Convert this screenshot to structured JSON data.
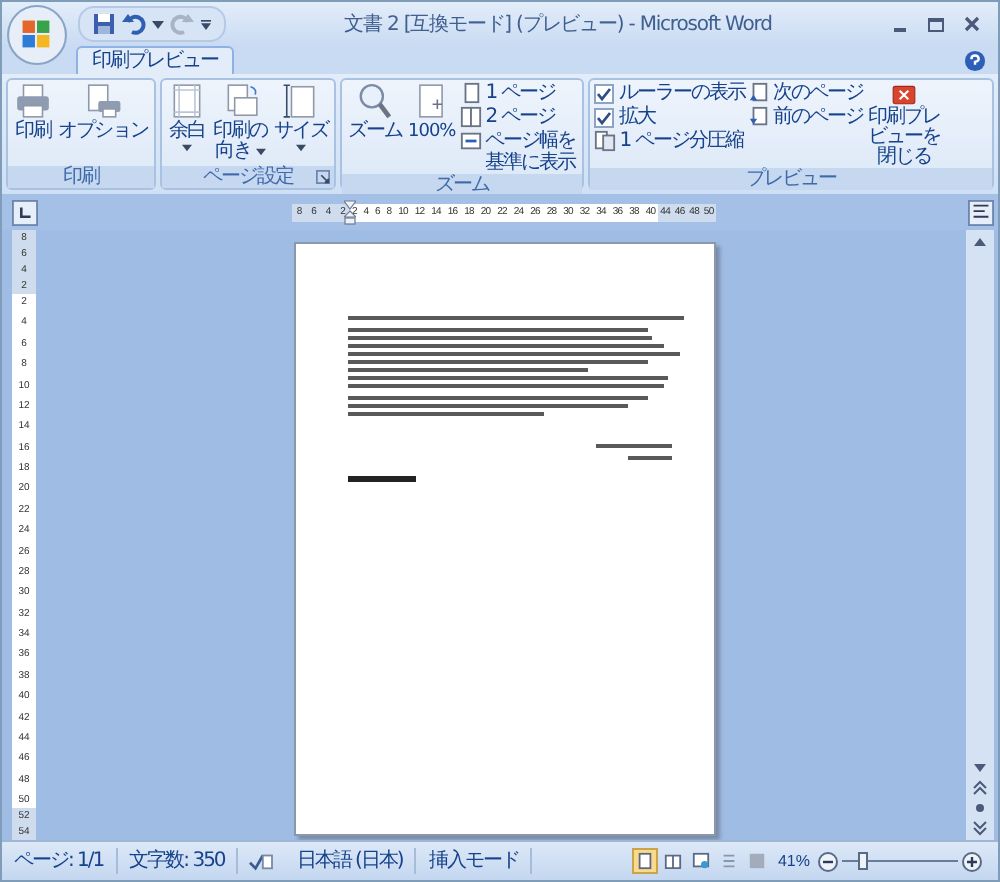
{
  "window": {
    "title": "文書 2 [互換モード] (プレビュー) - Microsoft Word"
  },
  "tabs": [
    {
      "label": "印刷プレビュー",
      "selected": true
    }
  ],
  "ribbon": {
    "print": {
      "label": "印刷",
      "buttons": [
        "印刷",
        "オプション"
      ]
    },
    "page_setup": {
      "label": "ページ設定",
      "buttons": [
        "余白",
        "印刷の向き",
        "サイズ"
      ]
    },
    "zoom": {
      "label": "ズーム",
      "large_buttons": [
        "ズーム",
        "100%"
      ],
      "small_buttons": [
        "1 ページ",
        "2 ページ",
        "ページ幅を基準に表示"
      ]
    },
    "preview": {
      "label": "プレビュー",
      "checkboxes": [
        {
          "label": "ルーラーの表示",
          "checked": true
        },
        {
          "label": "拡大",
          "checked": true
        }
      ],
      "shrink_button": "1 ページ分圧縮",
      "nav_buttons": [
        "次のページ",
        "前のページ"
      ],
      "close_button": "印刷プレビューを閉じる"
    }
  },
  "ruler": {
    "left_numbers": [
      "8",
      "6",
      "4",
      "2"
    ],
    "numbers": [
      "2",
      "4",
      "6",
      "8",
      "10",
      "12",
      "14",
      "16",
      "18",
      "20",
      "22",
      "24",
      "26",
      "28",
      "30",
      "32",
      "34",
      "36",
      "38",
      "40"
    ],
    "right_numbers": [
      "44",
      "46",
      "48",
      "50"
    ]
  },
  "vertical_ruler": {
    "top_numbers": [
      "8",
      "6",
      "4",
      "2"
    ],
    "numbers": [
      "2",
      "4",
      "6",
      "8",
      "10",
      "12",
      "14",
      "16",
      "18",
      "20",
      "22",
      "24",
      "26",
      "28",
      "30",
      "32",
      "34",
      "36",
      "38",
      "40",
      "42",
      "44",
      "46",
      "48",
      "50"
    ],
    "bottom_numbers": [
      "52",
      "54"
    ]
  },
  "status_bar": {
    "page": "ページ: 1/1",
    "word_count": "文字数: 350",
    "language": "日本語 (日本)",
    "mode": "挿入モード",
    "views": [
      {
        "selected": true
      },
      {
        "selected": false
      },
      {
        "selected": false
      },
      {
        "selected": false
      },
      {
        "selected": false
      }
    ],
    "zoom": {
      "reading": "41%",
      "level": 0.17
    }
  }
}
